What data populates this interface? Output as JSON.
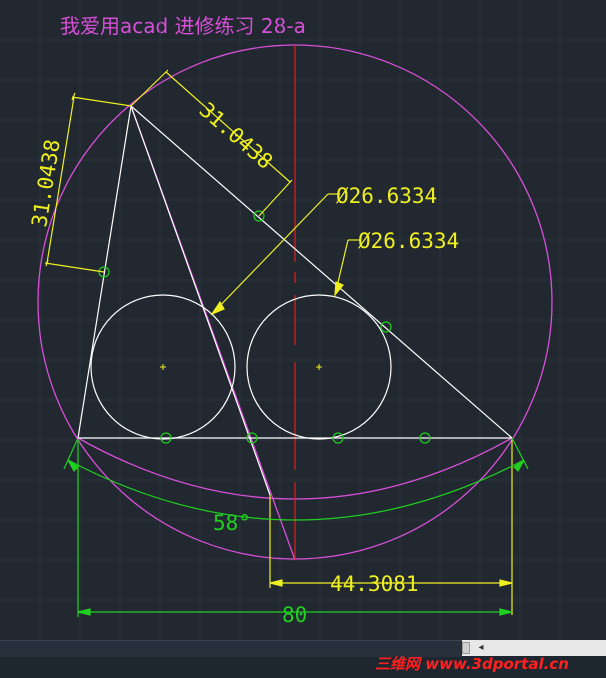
{
  "title": "我爱用acad  进修练习 28-a",
  "dimensions": {
    "slant_left": "31.0438",
    "slant_top": "31.0438",
    "dia_left": "Ø26.6334",
    "dia_right": "Ø26.6334",
    "angle": "58°",
    "offset": "44.3081",
    "overall": "80"
  },
  "watermark": {
    "brand": "三维网",
    "url": "www.3dportal.cn"
  },
  "colors": {
    "background": "#212830",
    "geometry": "#ffffff",
    "outer_circle": "#d84fd8",
    "centerline": "#e02020",
    "dimension": "#f0f020",
    "angle_dim": "#20d020",
    "snap_marker": "#20d020"
  }
}
